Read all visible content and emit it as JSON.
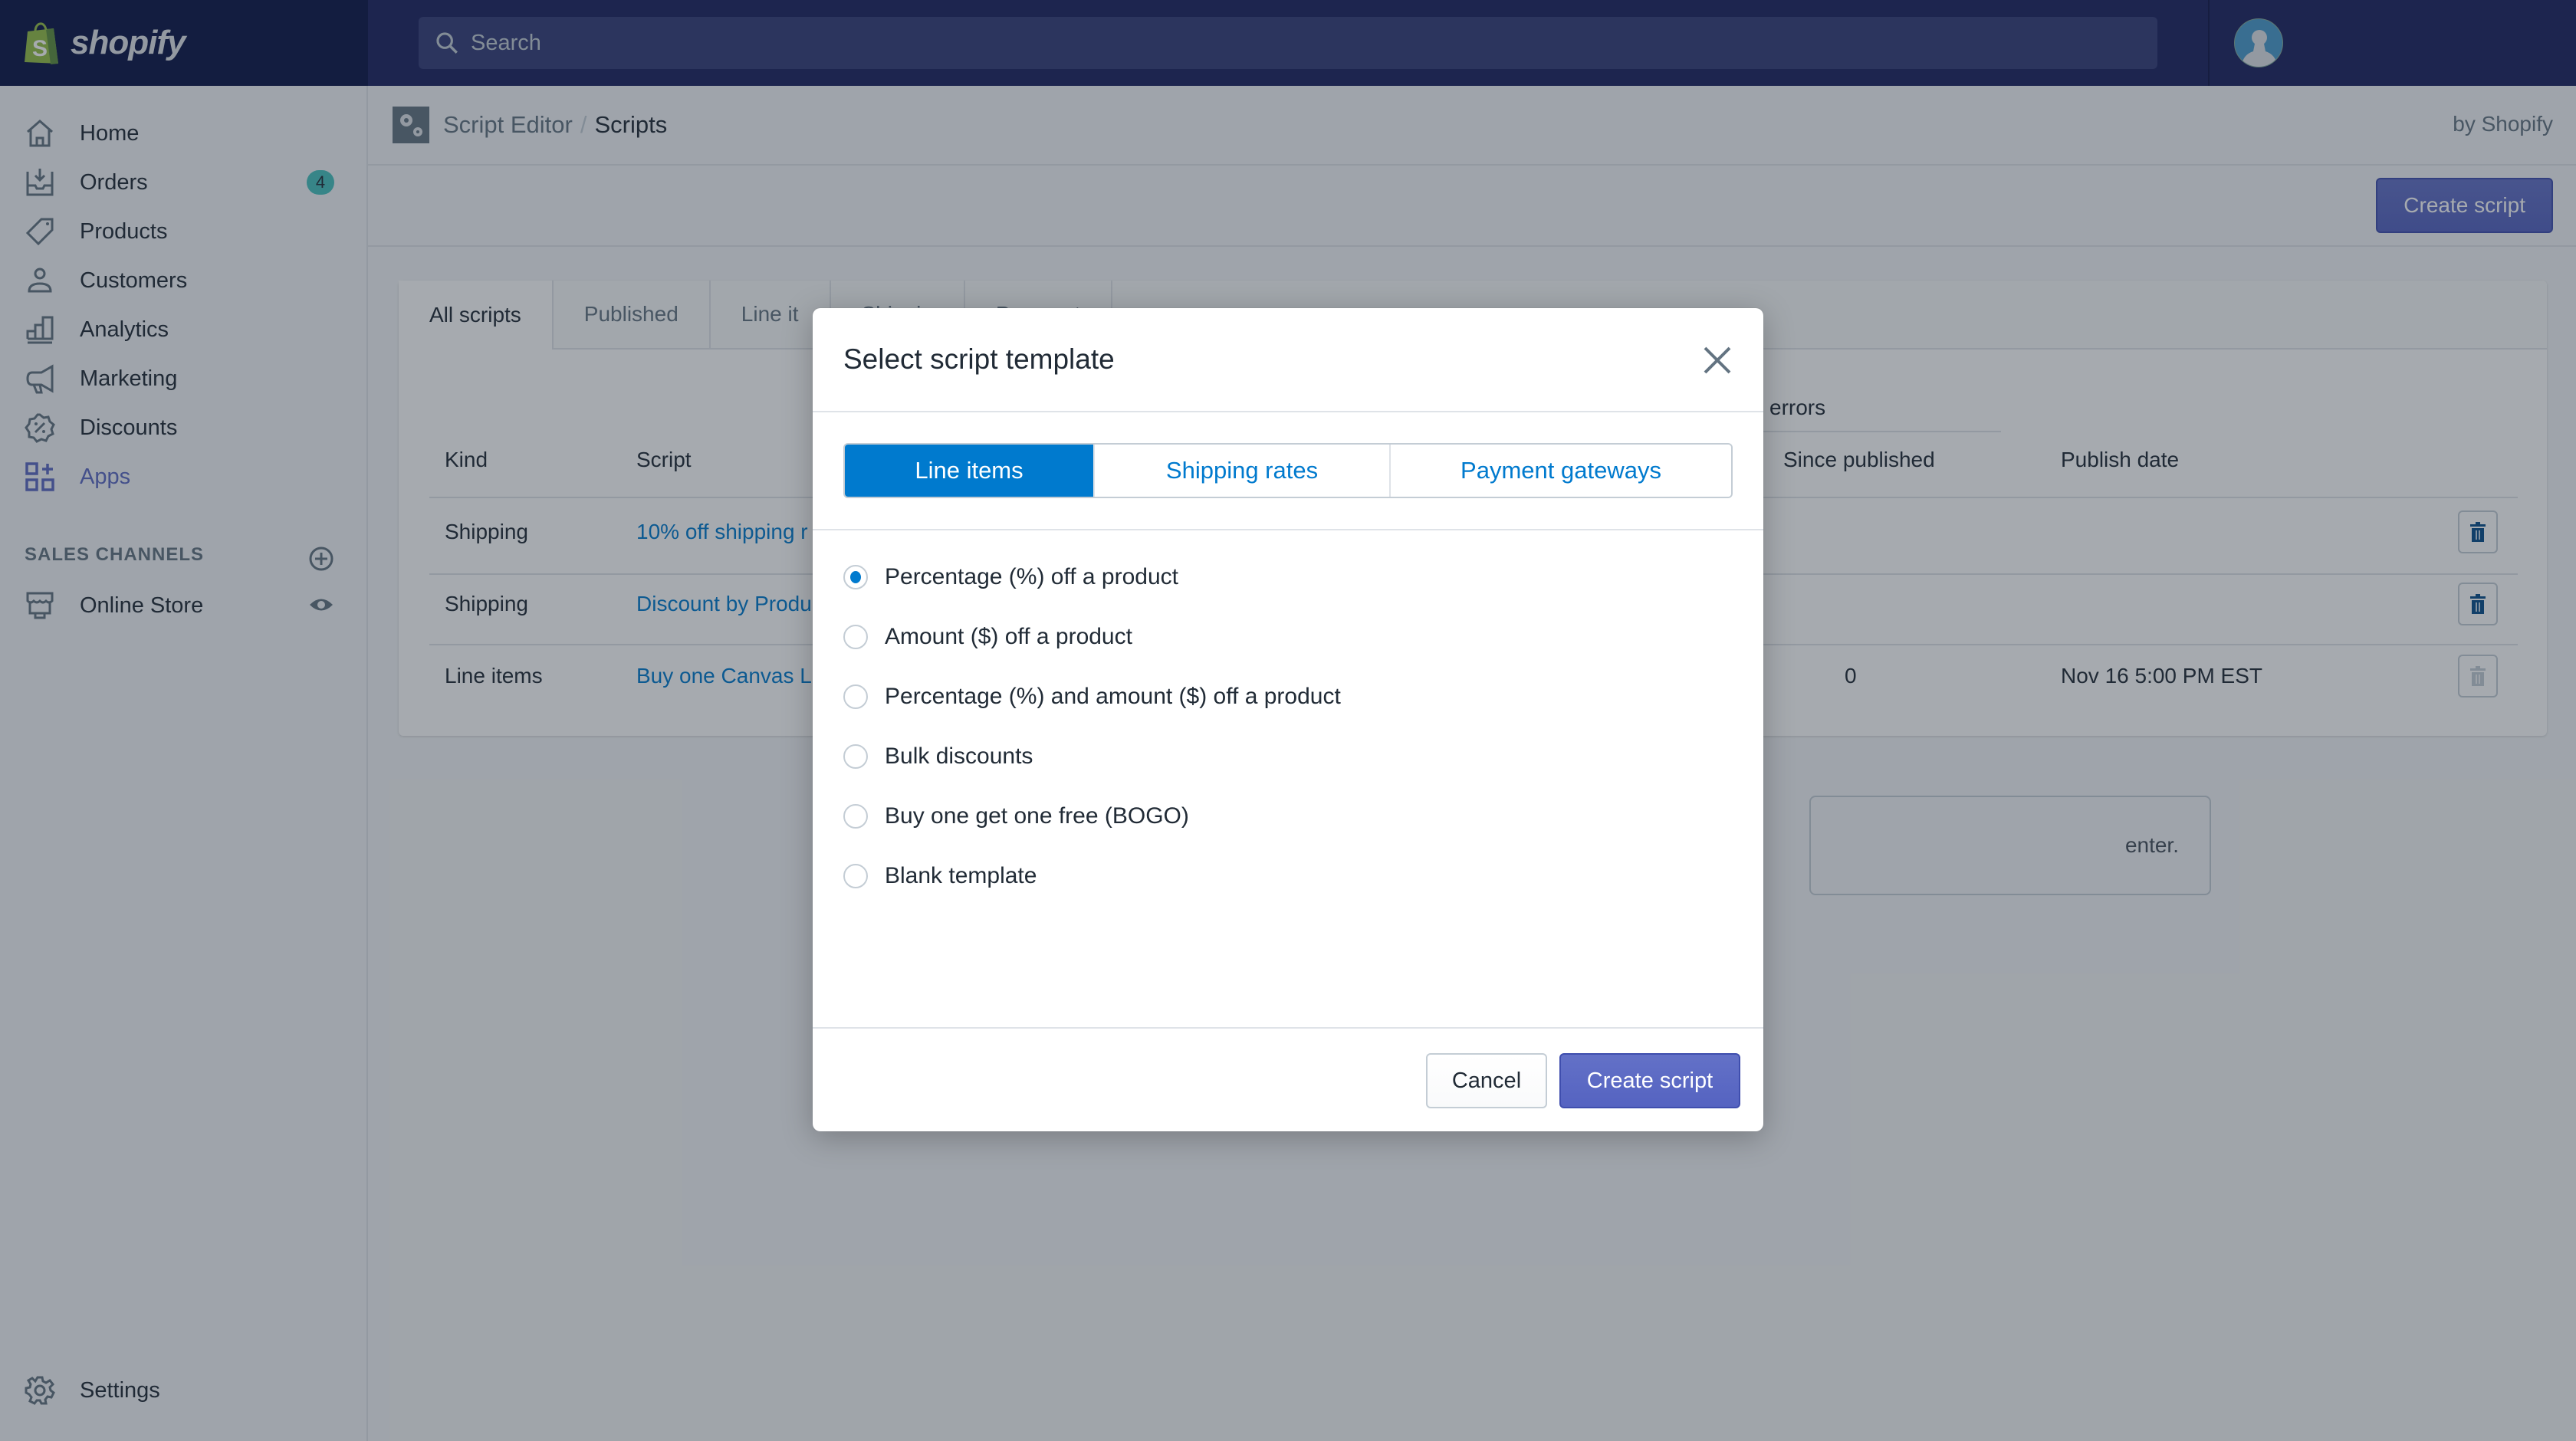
{
  "topbar": {
    "brand": "shopify",
    "search_placeholder": "Search"
  },
  "sidebar": {
    "items": [
      {
        "label": "Home",
        "icon": "home-icon"
      },
      {
        "label": "Orders",
        "icon": "orders-icon",
        "badge": "4"
      },
      {
        "label": "Products",
        "icon": "tag-icon"
      },
      {
        "label": "Customers",
        "icon": "person-icon"
      },
      {
        "label": "Analytics",
        "icon": "bar-chart-icon"
      },
      {
        "label": "Marketing",
        "icon": "megaphone-icon"
      },
      {
        "label": "Discounts",
        "icon": "discount-icon"
      },
      {
        "label": "Apps",
        "icon": "apps-icon",
        "active": true
      }
    ],
    "sales_channels_heading": "SALES CHANNELS",
    "online_store": "Online Store",
    "settings": "Settings"
  },
  "page": {
    "breadcrumb_parent": "Script Editor",
    "breadcrumb_separator": "/",
    "breadcrumb_current": "Scripts",
    "by_line": "by Shopify",
    "create_script": "Create script",
    "tabs": [
      "All scripts",
      "Published",
      "Line it",
      "Shippin",
      "Payment"
    ],
    "errors_label": "errors",
    "table": {
      "headers": [
        "Kind",
        "Script",
        "Since published",
        "Publish date"
      ],
      "rows": [
        {
          "kind": "Shipping",
          "script": "10% off shipping r",
          "since_published": "",
          "publish_date": ""
        },
        {
          "kind": "Shipping",
          "script": "Discount by Produ",
          "since_published": "",
          "publish_date": ""
        },
        {
          "kind": "Line items",
          "script": "Buy one Canvas L",
          "since_published": "0",
          "publish_date": "Nov 16 5:00 PM EST"
        }
      ]
    },
    "help_text_fragment": "enter."
  },
  "modal": {
    "title": "Select script template",
    "segments": [
      {
        "label": "Line items",
        "active": true
      },
      {
        "label": "Shipping rates",
        "active": false
      },
      {
        "label": "Payment gateways",
        "active": false
      }
    ],
    "options": [
      {
        "label": "Percentage (%) off a product",
        "checked": true
      },
      {
        "label": "Amount ($) off a product",
        "checked": false
      },
      {
        "label": "Percentage (%) and amount ($) off a product",
        "checked": false
      },
      {
        "label": "Bulk discounts",
        "checked": false
      },
      {
        "label": "Buy one get one free (BOGO)",
        "checked": false
      },
      {
        "label": "Blank template",
        "checked": false
      }
    ],
    "cancel": "Cancel",
    "create": "Create script"
  },
  "colors": {
    "topbar": "#1c2260",
    "primary": "#5c6ac4",
    "segment_active": "#007ace",
    "badge": "#47c1bf"
  }
}
